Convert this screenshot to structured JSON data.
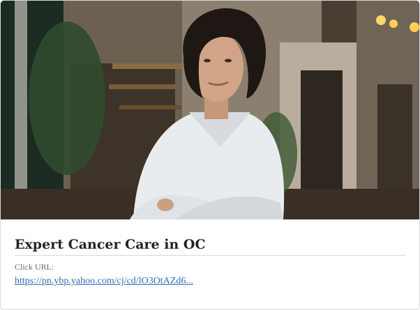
{
  "ad": {
    "image_alt": "Smiling woman with curly hair and arms crossed",
    "title": "Expert Cancer Care in OC",
    "url_label": "Click URL:",
    "url_text": "https://pn.ybp.yahoo.com/cj/cd/lO3OtAZd6..."
  },
  "colors": {
    "link": "#2f6db5",
    "title": "#1f2428",
    "divider": "#d7d7d7"
  }
}
